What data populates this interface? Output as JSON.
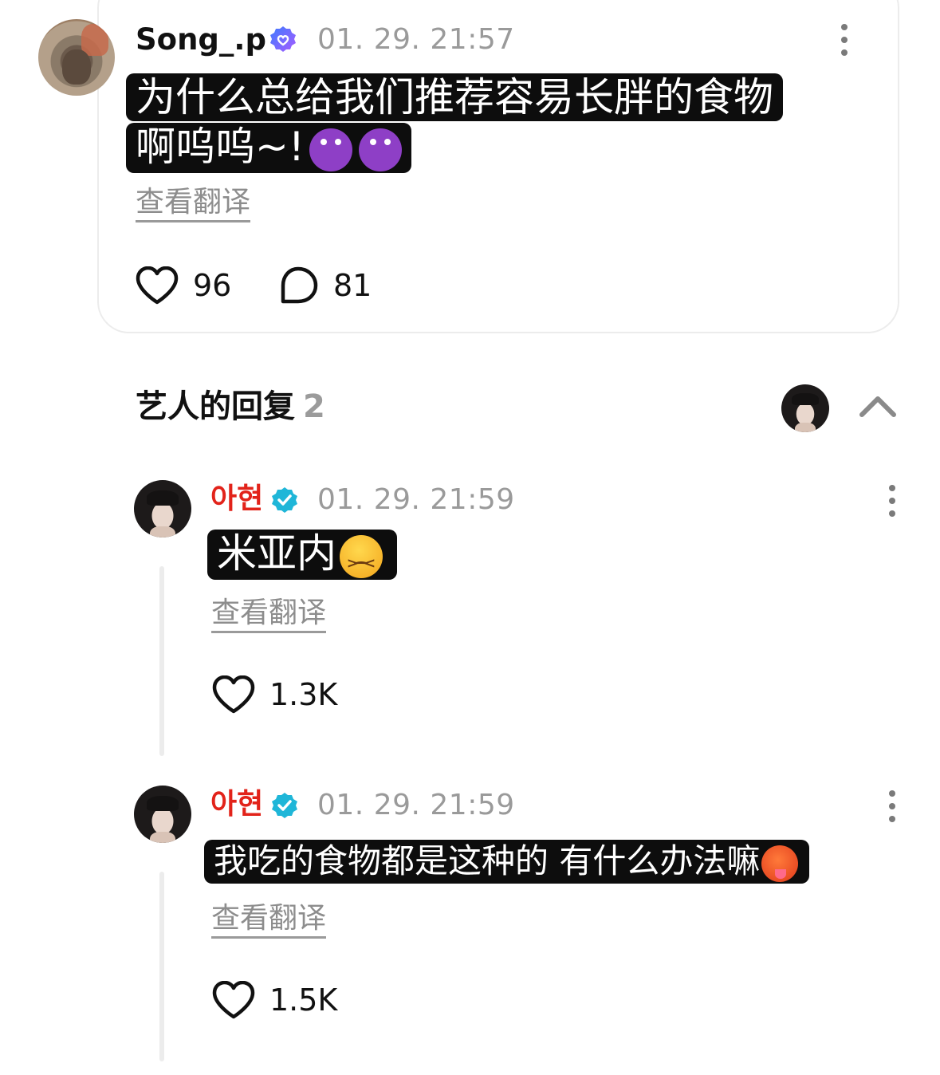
{
  "post": {
    "username": "Song_.p",
    "timestamp": "01. 29. 21:57",
    "text_lines": [
      "为什么总给我们推荐容易长胖的食物",
      "啊呜呜~!"
    ],
    "emoji": [
      "smiling-devil",
      "smiling-devil"
    ],
    "translate_label": "查看翻译",
    "like_count": "96",
    "comment_count": "81"
  },
  "replies_section": {
    "title": "艺人的回复",
    "count": "2"
  },
  "replies": [
    {
      "username": "아현",
      "timestamp": "01. 29. 21:59",
      "text": "米亚内",
      "emoji": "persevering-face",
      "translate_label": "查看翻译",
      "like_count": "1.3K"
    },
    {
      "username": "아현",
      "timestamp": "01. 29. 21:59",
      "text": "我吃的食物都是这种的 有什么办法嘛",
      "emoji": "hot-face",
      "translate_label": "查看翻译",
      "like_count": "1.5K"
    }
  ],
  "colors": {
    "artist_name": "#e2231a",
    "fan_badge": "#7b61ff",
    "artist_badge": "#1fb6d8",
    "muted": "#9a9a9a"
  }
}
